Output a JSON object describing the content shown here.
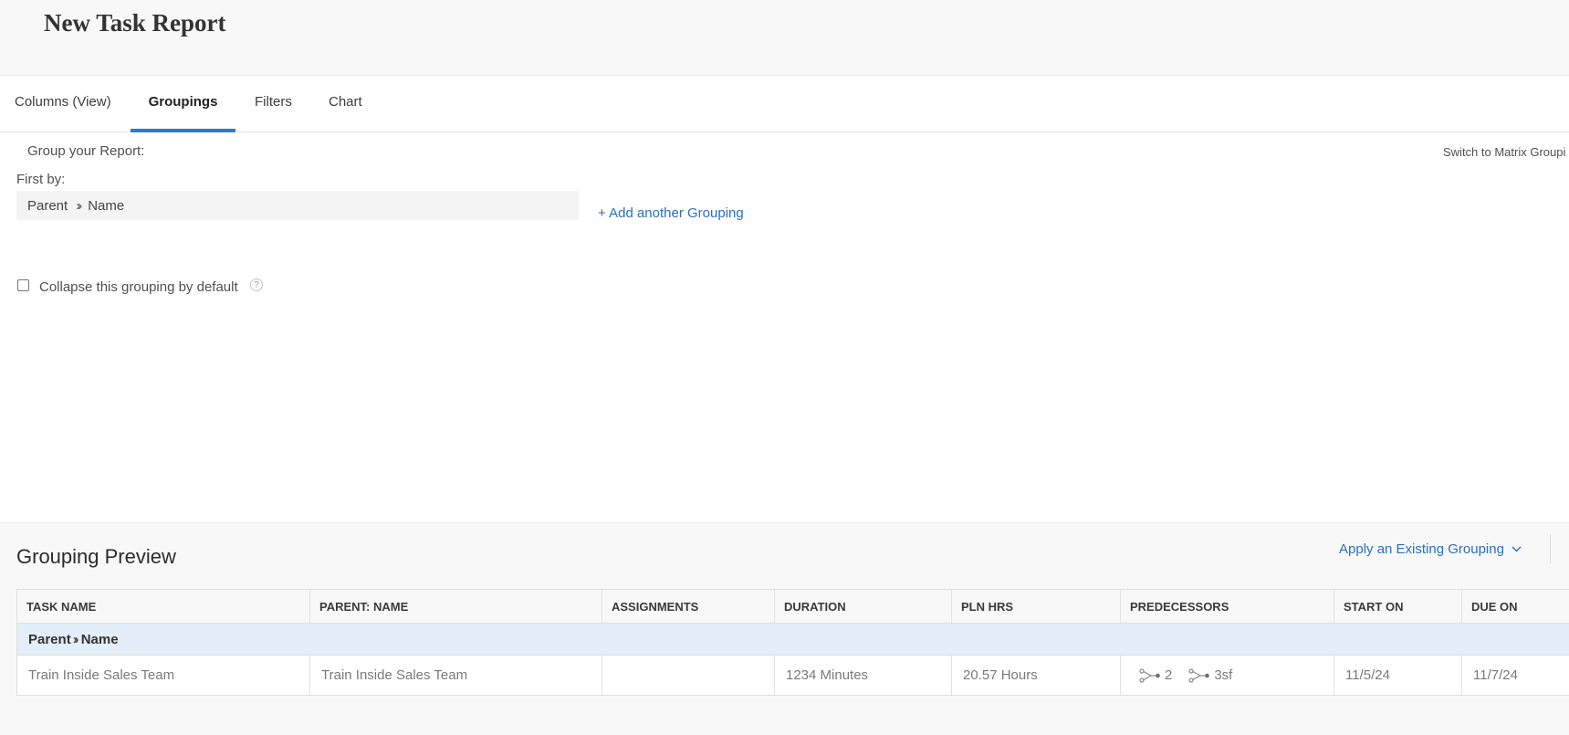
{
  "page": {
    "title": "New Task Report"
  },
  "tabs": [
    {
      "label": "Columns (View)",
      "active": false
    },
    {
      "label": "Groupings",
      "active": true
    },
    {
      "label": "Filters",
      "active": false
    },
    {
      "label": "Chart",
      "active": false
    }
  ],
  "grouping": {
    "heading": "Group your Report:",
    "switch_link": "Switch to Matrix Groupi",
    "first_by_label": "First by:",
    "field_part1": "Parent",
    "field_part2": "Name",
    "add_link": "+ Add another Grouping",
    "collapse_label": "Collapse this grouping by default",
    "collapse_checked": false,
    "help_glyph": "?"
  },
  "preview": {
    "title": "Grouping Preview",
    "apply_link": "Apply an Existing Grouping",
    "columns": [
      "TASK NAME",
      "PARENT: NAME",
      "ASSIGNMENTS",
      "DURATION",
      "PLN HRS",
      "PREDECESSORS",
      "START ON",
      "DUE ON"
    ],
    "group_row": {
      "part1": "Parent",
      "part2": "Name"
    },
    "row": {
      "task_name": "Train Inside Sales Team",
      "parent_name": "Train Inside Sales Team",
      "assignments": "",
      "duration": "1234 Minutes",
      "pln_hrs": "20.57 Hours",
      "predecessors": [
        "2",
        "3sf"
      ],
      "start_on": "11/5/24",
      "due_on": "11/7/24"
    }
  },
  "colors": {
    "accent": "#2b7ad6",
    "link": "#2b6fc2",
    "group_row_bg": "#e3eef8"
  },
  "icons": {
    "breadcrumb_separator": "chevron-double-right-icon",
    "dropdown": "chevron-down-icon",
    "predecessor": "predecessor-icon",
    "help": "help-icon"
  }
}
